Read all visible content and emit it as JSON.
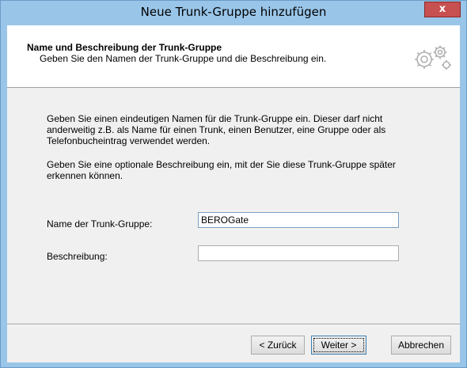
{
  "window": {
    "title": "Neue Trunk-Gruppe hinzufügen",
    "close_label": "x"
  },
  "header": {
    "title": "Name und Beschreibung der Trunk-Gruppe",
    "subtitle": "Geben Sie den Namen der Trunk-Gruppe und die Beschreibung ein.",
    "icon": "gears-icon"
  },
  "body": {
    "paragraph1": "Geben Sie einen eindeutigen Namen für die Trunk-Gruppe ein. Dieser darf nicht anderweitig z.B. als Name für einen Trunk, einen Benutzer, eine Gruppe oder als Telefonbucheintrag verwendet werden.",
    "paragraph2": "Geben Sie eine optionale Beschreibung ein, mit der Sie diese Trunk-Gruppe später erkennen können."
  },
  "form": {
    "name_label": "Name der Trunk-Gruppe:",
    "name_value": "BEROGate",
    "description_label": "Beschreibung:",
    "description_value": ""
  },
  "buttons": {
    "back": "< Zurück",
    "next": "Weiter >",
    "cancel": "Abbrechen"
  },
  "colors": {
    "titlebar": "#99c5e8",
    "close_button": "#c75050"
  }
}
